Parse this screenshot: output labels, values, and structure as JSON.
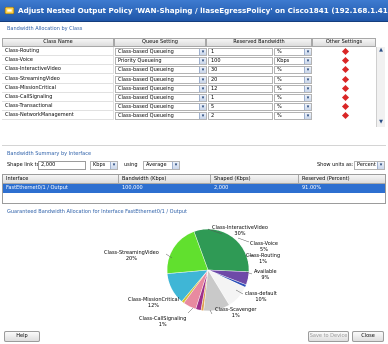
{
  "window": {
    "title": "Adjust Nested Output Policy 'WAN-Shaping / lIaseEgressPolicy' on Cisco1841 (192.168.1.41)"
  },
  "bandwidth_allocation": {
    "heading": "Bandwidth Allocation by Class",
    "columns": [
      "Class Name",
      "Queue Setting",
      "Reserved Bandwidth",
      "Other Settings"
    ],
    "rows": [
      {
        "name": "Class-Routing",
        "queue": "Class-based Queueing",
        "value": "1",
        "unit": "%"
      },
      {
        "name": "Class-Voice",
        "queue": "Priority Queueing",
        "value": "100",
        "unit": "Kbps"
      },
      {
        "name": "Class-InteractiveVideo",
        "queue": "Class-based Queueing",
        "value": "30",
        "unit": "%"
      },
      {
        "name": "Class-StreamingVideo",
        "queue": "Class-based Queueing",
        "value": "20",
        "unit": "%"
      },
      {
        "name": "Class-MissionCritical",
        "queue": "Class-based Queueing",
        "value": "12",
        "unit": "%"
      },
      {
        "name": "Class-CallSignaling",
        "queue": "Class-based Queueing",
        "value": "1",
        "unit": "%"
      },
      {
        "name": "Class-Transactional",
        "queue": "Class-based Queueing",
        "value": "5",
        "unit": "%"
      },
      {
        "name": "Class-NetworkManagement",
        "queue": "Class-based Queueing",
        "value": "2",
        "unit": "%"
      }
    ],
    "other_settings_color": "#d92626"
  },
  "summary": {
    "heading": "Bandwidth Summary by Interface",
    "shape_link_label": "Shape link to:",
    "shape_link_value": "2,000",
    "shape_unit": "Kbps",
    "using_label": "using",
    "using_value": "Average",
    "show_units_label": "Show units as:",
    "show_units_value": "Percent",
    "columns": [
      "Interface",
      "Bandwidth (Kbps)",
      "Shaped (Kbps)",
      "Reserved (Percent)"
    ],
    "row": {
      "interface": "FastEthernet0/1 / Output",
      "bandwidth": "100,000",
      "shaped": "2,000",
      "reserved": "91.00%"
    }
  },
  "guaranteed": {
    "heading": "Guaranteed Bandwidth Allocation for Interface FastEthernet0/1 / Output"
  },
  "chart_data": {
    "type": "pie",
    "title": "",
    "slices": [
      {
        "label": "Class-InteractiveVideo",
        "value": 30,
        "color": "#2f9a55"
      },
      {
        "label": "Class-Voice",
        "value": 5,
        "color": "#6e4aa8"
      },
      {
        "label": "Class-Routing",
        "value": 1,
        "color": "#2a4fb8"
      },
      {
        "label": "Available",
        "value": 9,
        "color": "#f4f4f4"
      },
      {
        "label": "class-default",
        "value": 10,
        "color": "#c9c9c9"
      },
      {
        "label": "Class-Scavenger",
        "value": 1,
        "color": "#e0a050"
      },
      {
        "label": "Class-NetworkManagement",
        "value": 2,
        "color": "#9d2f8b"
      },
      {
        "label": "Class-Transactional",
        "value": 5,
        "color": "#e88aa0"
      },
      {
        "label": "Class-CallSignaling",
        "value": 1,
        "color": "#d4c23a"
      },
      {
        "label": "Class-MissionCritical",
        "value": 12,
        "color": "#3fb6d6"
      },
      {
        "label": "Class-StreamingVideo",
        "value": 20,
        "color": "#61e02e"
      }
    ],
    "labels": [
      {
        "name": "Class-InteractiveVideo",
        "pct": "30%"
      },
      {
        "name": "Class-Voice",
        "pct": "5%"
      },
      {
        "name": "Class-Routing",
        "pct": "1%"
      },
      {
        "name": "Available",
        "pct": "9%"
      },
      {
        "name": "class-default",
        "pct": "10%"
      },
      {
        "name": "Class-Scavenger",
        "pct": "1%"
      },
      {
        "name": "Class-MissionCritical",
        "pct": "12%"
      },
      {
        "name": "Class-CallSignaling",
        "pct": "1%"
      },
      {
        "name": "Class-StreamingVideo",
        "pct": "20%"
      }
    ]
  },
  "footer": {
    "help": "Help",
    "save": "Save to Device",
    "close": "Close"
  },
  "icons": {
    "title_icon": "policy-icon",
    "dropdown": "chevron-down-icon"
  },
  "colors": {
    "accent": "#2c5fa8",
    "selection": "#2d6fd0",
    "title_bar": "#2a62b8"
  }
}
